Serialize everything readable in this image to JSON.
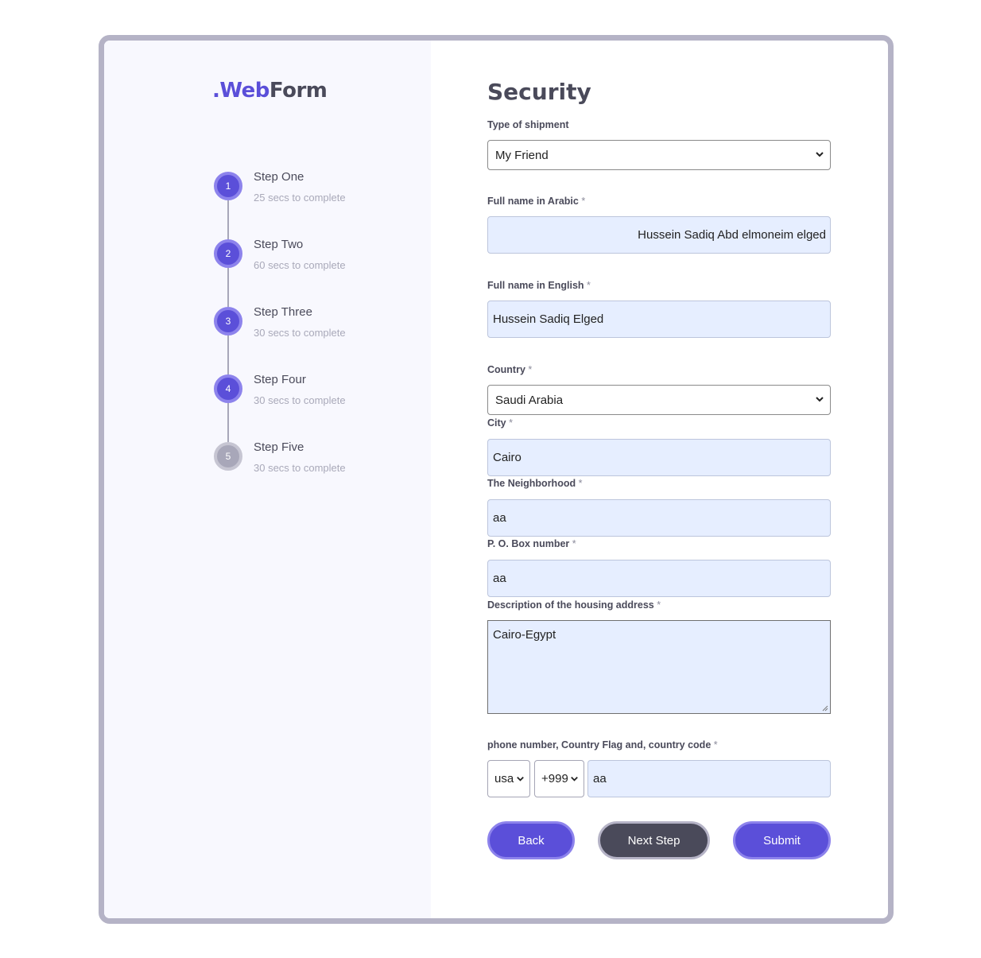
{
  "logo": {
    "dot": ".",
    "web": "Web",
    "form": "Form"
  },
  "steps": [
    {
      "number": "1",
      "title": "Step One",
      "subtitle": "25 secs to complete"
    },
    {
      "number": "2",
      "title": "Step Two",
      "subtitle": "60 secs to complete"
    },
    {
      "number": "3",
      "title": "Step Three",
      "subtitle": "30 secs to complete"
    },
    {
      "number": "4",
      "title": "Step Four",
      "subtitle": "30 secs to complete"
    },
    {
      "number": "5",
      "title": "Step Five",
      "subtitle": "30 secs to complete"
    }
  ],
  "form": {
    "title": "Security",
    "shipment_type": {
      "label": "Type of shipment",
      "value": "My Friend"
    },
    "name_arabic": {
      "label": "Full name in Arabic",
      "required": "*",
      "value": "Hussein Sadiq Abd elmoneim elged"
    },
    "name_english": {
      "label": "Full name in English",
      "required": "*",
      "value": "Hussein Sadiq Elged"
    },
    "country": {
      "label": "Country",
      "required": "*",
      "value": "Saudi Arabia"
    },
    "city": {
      "label": "City",
      "required": "*",
      "value": "Cairo"
    },
    "neighborhood": {
      "label": "The Neighborhood",
      "required": "*",
      "value": "aa"
    },
    "po_box": {
      "label": "P. O. Box number",
      "required": "*",
      "value": "aa"
    },
    "housing_description": {
      "label": "Description of the housing address",
      "required": "*",
      "value": "Cairo-Egypt"
    },
    "phone": {
      "label": "phone number, Country Flag and, country code",
      "required": "*",
      "country_flag": "usa",
      "country_code": "+999",
      "number": "aa"
    }
  },
  "buttons": {
    "back": "Back",
    "next": "Next Step",
    "submit": "Submit"
  },
  "colors": {
    "accent": "#5b4fd9",
    "dark": "#4a4a5a",
    "inactive": "#a8a7b9",
    "input_bg": "#e6eeff"
  }
}
